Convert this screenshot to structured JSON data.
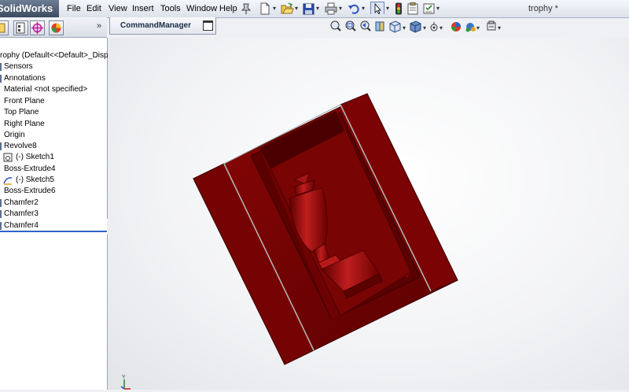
{
  "app": {
    "logo_text": "SolidWorks",
    "document_title": "trophy *"
  },
  "menu": {
    "items": [
      {
        "id": "file",
        "label": "File"
      },
      {
        "id": "edit",
        "label": "Edit"
      },
      {
        "id": "view",
        "label": "View"
      },
      {
        "id": "insert",
        "label": "Insert"
      },
      {
        "id": "tools",
        "label": "Tools"
      },
      {
        "id": "window",
        "label": "Window"
      },
      {
        "id": "help",
        "label": "Help"
      }
    ]
  },
  "toolbar": {
    "icons": [
      "pin-icon",
      "new-document-icon",
      "open-folder-icon",
      "save-icon",
      "print-icon",
      "undo-icon",
      "select-arrow-icon",
      "rebuild-traffic-light-icon",
      "file-properties-icon",
      "options-icon"
    ]
  },
  "panel_tabs": {
    "icons": [
      "feature-manager-tab-icon",
      "property-manager-tab-icon",
      "configuration-manager-tab-icon",
      "appearance-tab-icon"
    ],
    "more_glyph": "»"
  },
  "command_manager": {
    "label": "CommandManager"
  },
  "view_toolbar": {
    "icons": [
      "zoom-to-fit-icon",
      "zoom-to-area-icon",
      "previous-view-icon",
      "section-view-icon",
      "view-orientation-icon",
      "display-style-icon",
      "hide-show-items-icon",
      "edit-appearance-icon",
      "apply-scene-icon",
      "view-settings-icon"
    ]
  },
  "feature_tree": {
    "items": [
      {
        "label": "rophy  (Default<<Default>_Displa",
        "icon": "part-icon"
      },
      {
        "label": "Sensors",
        "icon": "sensors-folder-icon"
      },
      {
        "label": "Annotations",
        "icon": "annotations-icon"
      },
      {
        "label": "Material <not specified>",
        "icon": "material-icon"
      },
      {
        "label": "Front Plane",
        "icon": "plane-icon"
      },
      {
        "label": "Top Plane",
        "icon": "plane-icon"
      },
      {
        "label": "Right Plane",
        "icon": "plane-icon"
      },
      {
        "label": "Origin",
        "icon": "origin-icon"
      },
      {
        "label": "Revolve8",
        "icon": "revolve-icon"
      },
      {
        "label": "(-) Sketch1",
        "icon": "sketch-icon"
      },
      {
        "label": "Boss-Extrude4",
        "icon": "extrude-icon"
      },
      {
        "label": "(-) Sketch5",
        "icon": "sketch-icon"
      },
      {
        "label": "Boss-Extrude6",
        "icon": "extrude-icon"
      },
      {
        "label": "Chamfer2",
        "icon": "chamfer-icon"
      },
      {
        "label": "Chamfer3",
        "icon": "chamfer-icon"
      },
      {
        "label": "Chamfer4",
        "icon": "chamfer-icon"
      }
    ]
  },
  "viewport": {
    "model_name": "trophy",
    "model_color": "#7a0000",
    "axis_label": "Y"
  }
}
